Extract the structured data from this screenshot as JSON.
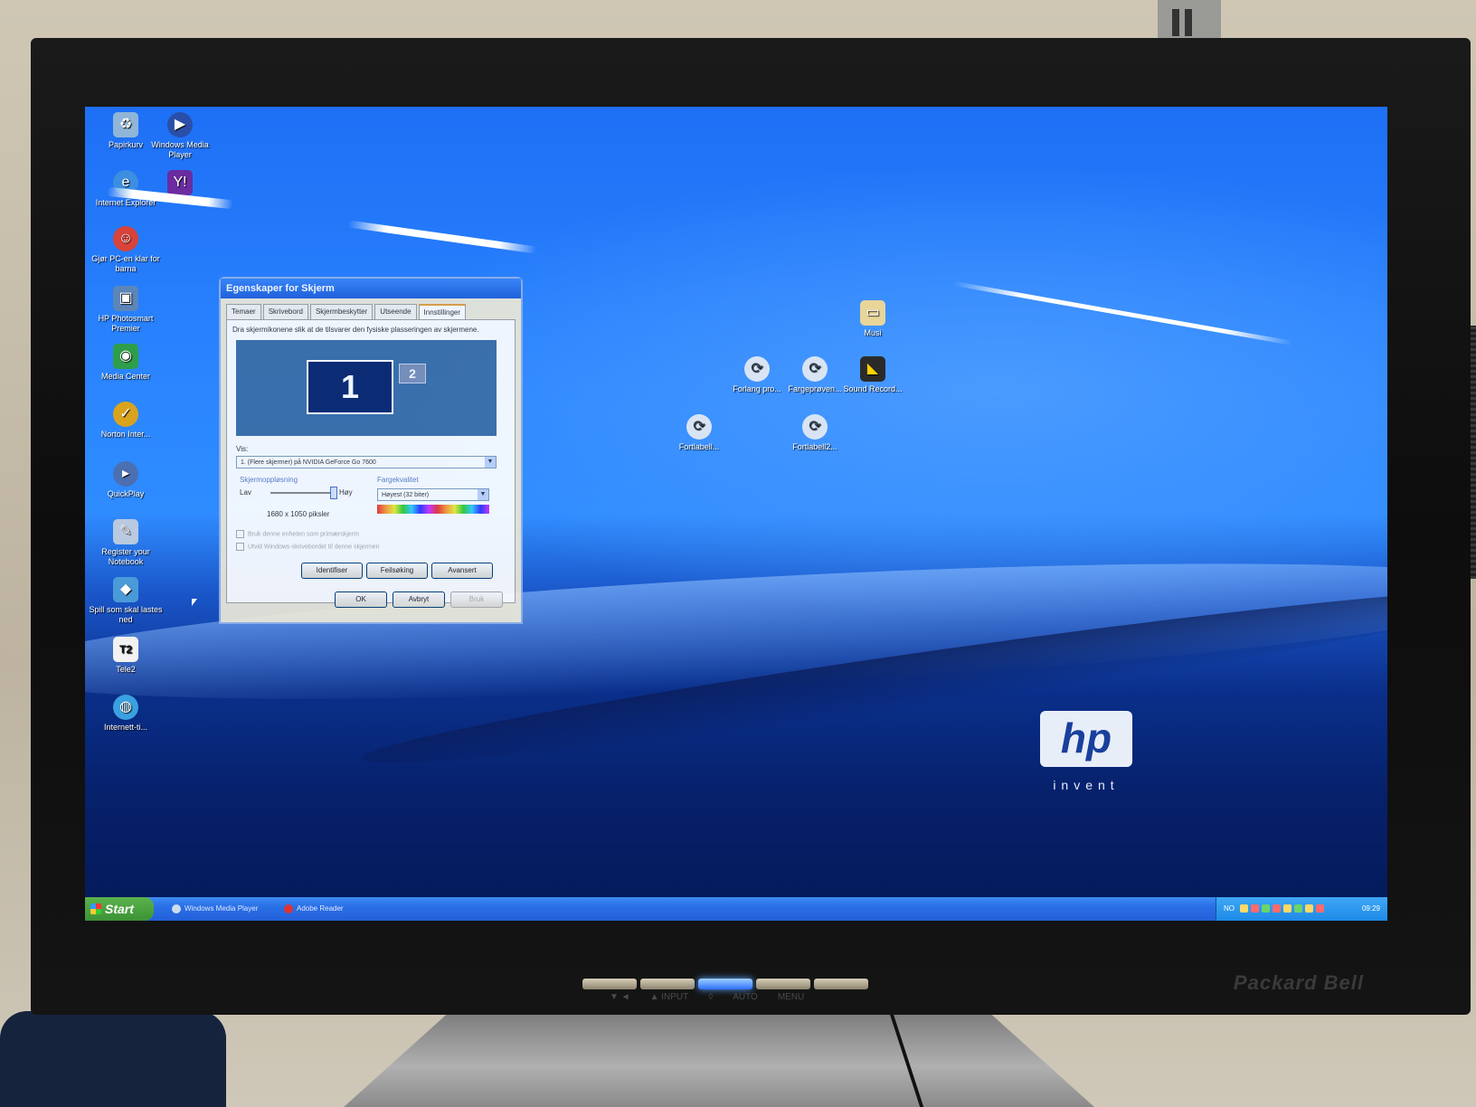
{
  "monitor": {
    "brand": "Packard Bell",
    "front_labels": [
      "▼ ◄",
      "▲ INPUT",
      "◊",
      "AUTO",
      "MENU"
    ]
  },
  "desktop_icons": [
    {
      "label": "Papirkurv",
      "icon": "recycle-bin-icon"
    },
    {
      "label": "Windows Media Player",
      "icon": "media-player-icon"
    },
    {
      "label": "Internet Explorer",
      "icon": "internet-explorer-icon"
    },
    {
      "label": "",
      "icon": "yahoo-icon"
    },
    {
      "label": "Gjør PC-en klar for barna",
      "icon": "parental-icon"
    },
    {
      "label": "HP Photosmart Premier",
      "icon": "photosmart-icon"
    },
    {
      "label": "Media Center",
      "icon": "media-center-icon"
    },
    {
      "label": "Norton Inter...",
      "icon": "norton-icon"
    },
    {
      "label": "QuickPlay",
      "icon": "quickplay-icon"
    },
    {
      "label": "Register your Notebook",
      "icon": "register-icon"
    },
    {
      "label": "Spill som skal lastes ned",
      "icon": "games-icon"
    },
    {
      "label": "Tele2",
      "icon": "tele2-icon"
    },
    {
      "label": "Internett-ti...",
      "icon": "internet-icon"
    }
  ],
  "center_icons": [
    {
      "label": "Musi",
      "icon": "folder-icon"
    },
    {
      "label": "Forlang pro...",
      "icon": "shortcut-icon"
    },
    {
      "label": "Fargeprøven...",
      "icon": "shortcut-icon"
    },
    {
      "label": "Sound Record...",
      "icon": "audio-app-icon"
    },
    {
      "label": "Fortlabell...",
      "icon": "shortcut-icon"
    },
    {
      "label": "Fortlabell2...",
      "icon": "shortcut-icon"
    }
  ],
  "dialog": {
    "title": "Egenskaper for Skjerm",
    "tabs": [
      "Temaer",
      "Skrivebord",
      "Skjermbeskytter",
      "Utseende",
      "Innstillinger"
    ],
    "active_tab": "Innstillinger",
    "hint": "Dra skjermikonene slik at de tilsvarer den fysiske plasseringen av skjermene.",
    "monitor1": "1",
    "monitor2": "2",
    "display_label": "Vis:",
    "display_value": "1. (Flere skjermer) på NVIDIA GeForce Go 7600",
    "resolution_label": "Skjermoppløsning",
    "low": "Lav",
    "high": "Høy",
    "resolution_value": "1680 x 1050 piksler",
    "color_label": "Fargekvalitet",
    "color_value": "Høyest (32 biter)",
    "check1": "Bruk denne enheten som primærskjerm",
    "check2": "Utvid Windows-skrivebordet til denne skjermen",
    "btn_identify": "Identifiser",
    "btn_troubleshoot": "Feilsøking",
    "btn_advanced": "Avansert",
    "btn_ok": "OK",
    "btn_cancel": "Avbryt",
    "btn_apply": "Bruk"
  },
  "taskbar": {
    "start": "Start",
    "tasks": [
      "Windows Media Player",
      "Adobe Reader"
    ],
    "tray_text": "NO",
    "clock": "09:29"
  },
  "wallpaper": {
    "logo": "hp",
    "tagline": "invent"
  }
}
